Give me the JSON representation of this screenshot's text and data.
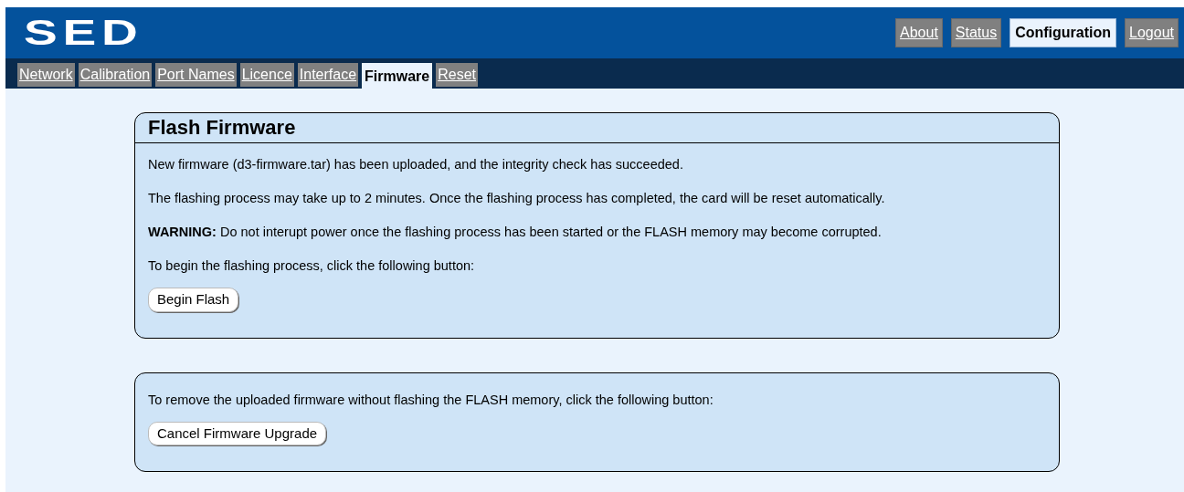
{
  "logo": "SED",
  "top_nav": [
    {
      "label": "About",
      "selected": false
    },
    {
      "label": "Status",
      "selected": false
    },
    {
      "label": "Configuration",
      "selected": true
    },
    {
      "label": "Logout",
      "selected": false
    }
  ],
  "tabs": [
    {
      "label": "Network",
      "selected": false
    },
    {
      "label": "Calibration",
      "selected": false
    },
    {
      "label": "Port Names",
      "selected": false
    },
    {
      "label": "Licence",
      "selected": false
    },
    {
      "label": "Interface",
      "selected": false
    },
    {
      "label": "Firmware",
      "selected": true
    },
    {
      "label": "Reset",
      "selected": false
    }
  ],
  "panels": [
    {
      "title": "Flash Firmware",
      "paragraphs": [
        "New firmware (d3-firmware.tar) has been uploaded, and the integrity check has succeeded.",
        "The flashing process may take up to 2 minutes. Once the flashing process has completed, the card will be reset automatically.",
        "**WARNING:** Do not interupt power once the flashing process has been started or the FLASH memory may become corrupted.",
        "To begin the flashing process, click the following button:"
      ],
      "button": "Begin Flash"
    },
    {
      "paragraphs": [
        "To remove the uploaded firmware without flashing the FLASH memory, click the following button:"
      ],
      "button": "Cancel Firmware Upgrade"
    }
  ]
}
